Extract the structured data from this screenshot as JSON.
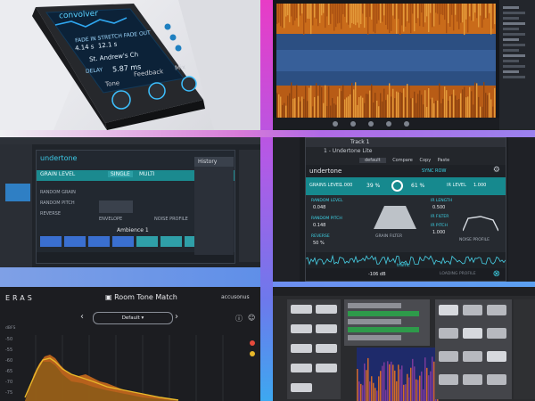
{
  "device": {
    "brand": "convolver",
    "fade_in": "FADE IN",
    "stretch": "STRETCH",
    "fade_out": "FADE OUT",
    "val1": "4.14 s",
    "val2": "12.1 s",
    "preset": "St. Andrew's Ch",
    "delay_label": "DELAY",
    "delay_value": "5.87 ms",
    "tone": "Tone",
    "feedback": "Feedback",
    "mix": "Mix"
  },
  "t3": {
    "brand": "undertone",
    "single": "SINGLE",
    "multi": "MULTI",
    "history": "History",
    "grain_level": "GRAIN LEVEL",
    "random_grain": "RANDOM GRAIN",
    "random_pitch": "RANDOM PITCH",
    "reverse": "REVERSE",
    "envelope": "ENVELOPE",
    "noise_profile": "NOISE PROFILE",
    "ambience": "Ambience 1"
  },
  "t4": {
    "track": "Track 1",
    "plugin": "1 - Undertone Lite",
    "preset": "default",
    "compare": "Compare",
    "copy": "Copy",
    "paste": "Paste",
    "brand": "undertone",
    "sync": "SYNC ROW",
    "grains_level_label": "GRAINS LEVEL",
    "grains_level_value": "1.000",
    "knob1": "39 %",
    "knob2": "61 %",
    "ir_level_label": "IR LEVEL",
    "ir_level_value": "1.000",
    "random_level": "RANDOM LEVEL",
    "random_level_value": "0.048",
    "random_pitch": "RANDOM PITCH",
    "random_pitch_value": "0.148",
    "ir_length": "IR LENGTH",
    "ir_length_value": "0.500",
    "ir_filter": "IR FILTER",
    "ir_pitch": "IR PITCH",
    "ir_pitch_value": "1.000",
    "reverse": "REVERSE",
    "reverse_value": "50 %",
    "grain_filter": "GRAIN FILTER",
    "noise_profile": "NOISE PROFILE",
    "traffic": "traffic",
    "bottom_value": "-106 dB",
    "footer": "LOADING PROFILE"
  },
  "t5": {
    "brand": "ERAS",
    "title": "Room Tone Match",
    "company": "accusonus",
    "preset": "Default",
    "db_label": "dBFS",
    "y_ticks": [
      "-50",
      "-55",
      "-60",
      "-65",
      "-70",
      "-75"
    ]
  },
  "colors": {
    "accent_cyan": "#39c8ff",
    "accent_teal": "#2bb6a6",
    "spectro_orange": "#e08a2a",
    "eras_orange": "#e0701e"
  }
}
